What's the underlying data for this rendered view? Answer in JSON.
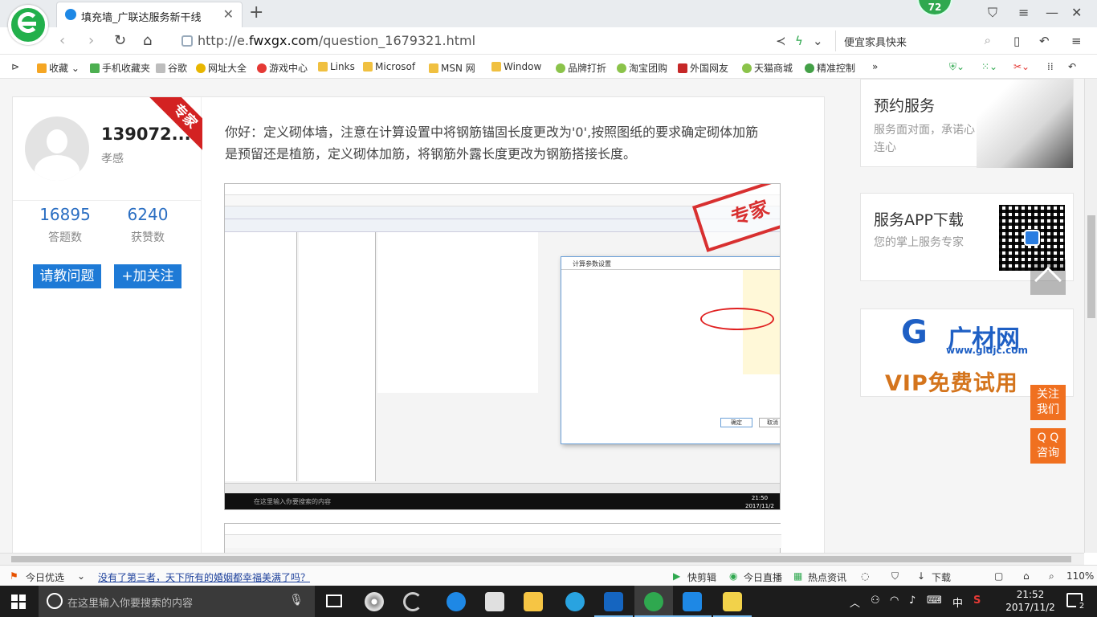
{
  "browser": {
    "tab_title": "填充墙_广联达服务新干线",
    "close_glyph": "✕",
    "newtab_glyph": "+",
    "badge": "72",
    "url_prefix": "http://e.",
    "url_domain": "fwxgx.com",
    "url_path": "/question_1679321.html",
    "search_query": "便宜家具快来",
    "bookmarks": [
      {
        "label": "收藏",
        "color": "#f5a623"
      },
      {
        "label": "手机收藏夹",
        "color": "#4caf50"
      },
      {
        "label": "谷歌",
        "color": "#9e9e9e"
      },
      {
        "label": "网址大全",
        "color": "#e8b600"
      },
      {
        "label": "游戏中心",
        "color": "#e53935"
      },
      {
        "label": "Links",
        "color": "#f0c040"
      },
      {
        "label": "Microsof",
        "color": "#f0c040"
      },
      {
        "label": "MSN 网",
        "color": "#f0c040"
      },
      {
        "label": "Window",
        "color": "#f0c040"
      },
      {
        "label": "品牌打折",
        "color": "#8bc34a"
      },
      {
        "label": "淘宝团购",
        "color": "#8bc34a"
      },
      {
        "label": "外国网友",
        "color": "#c62828"
      },
      {
        "label": "天猫商城",
        "color": "#8bc34a"
      },
      {
        "label": "精准控制",
        "color": "#43a047"
      }
    ],
    "bookmark_more": "»"
  },
  "profile": {
    "name": "139072...",
    "subtitle": "孝感",
    "ribbon": "专家",
    "answers_count": "16895",
    "answers_label": "答题数",
    "likes_count": "6240",
    "likes_label": "获赞数",
    "ask_button": "请教问题",
    "follow_button": "+加关注"
  },
  "answer": {
    "text": "你好：定义砌体墙，注意在计算设置中将钢筋锚固长度更改为'0',按照图纸的要求确定砌体加筋是预留还是植筋，定义砌体加筋，将钢筋外露长度更改为钢筋搭接长度。"
  },
  "screenshot": {
    "stamp": "专家",
    "dialog_title": "计算参数设置",
    "ok": "确定",
    "cancel": "取消",
    "clock": "21:50",
    "date": "2017/11/2",
    "search_placeholder": "在这里输入你要搜索的内容"
  },
  "ads": {
    "ad1_title": "预约服务",
    "ad1_sub": "服务面对面，承诺心连心",
    "ad2_title": "服务APP下载",
    "ad2_sub": "您的掌上服务专家",
    "ad3_logo": "G",
    "ad3_name": "广材网",
    "ad3_url": "www.gldjc.com",
    "ad3_vip": "VIP免费试用"
  },
  "float": {
    "follow_line1": "关注",
    "follow_line2": "我们",
    "qq_line1": "Q Q",
    "qq_line2": "咨询"
  },
  "infobar": {
    "today": "今日优选",
    "headline": "没有了第三者，天下所有的婚姻都幸福美满了吗？",
    "kuaijianji": "快剪辑",
    "live": "今日直播",
    "news": "热点资讯",
    "download": "下载",
    "zoom": "110%"
  },
  "taskbar": {
    "search_placeholder": "在这里输入你要搜索的内容",
    "ime": "中",
    "time": "21:52",
    "date": "2017/11/2",
    "notifications": "2"
  }
}
